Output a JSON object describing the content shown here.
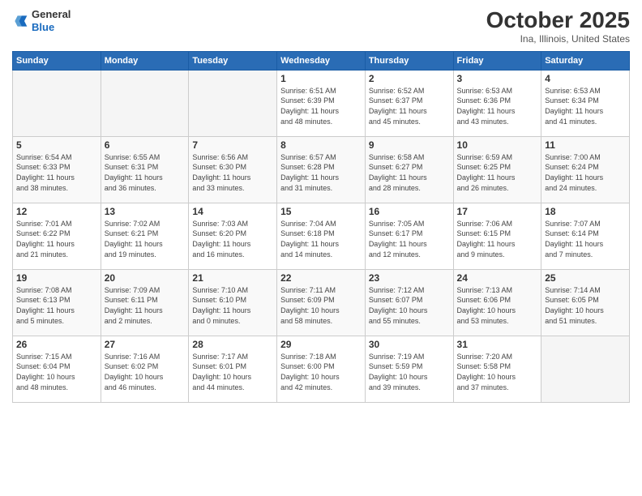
{
  "header": {
    "logo_general": "General",
    "logo_blue": "Blue",
    "month_title": "October 2025",
    "subtitle": "Ina, Illinois, United States"
  },
  "weekdays": [
    "Sunday",
    "Monday",
    "Tuesday",
    "Wednesday",
    "Thursday",
    "Friday",
    "Saturday"
  ],
  "weeks": [
    [
      {
        "day": "",
        "info": ""
      },
      {
        "day": "",
        "info": ""
      },
      {
        "day": "",
        "info": ""
      },
      {
        "day": "1",
        "info": "Sunrise: 6:51 AM\nSunset: 6:39 PM\nDaylight: 11 hours\nand 48 minutes."
      },
      {
        "day": "2",
        "info": "Sunrise: 6:52 AM\nSunset: 6:37 PM\nDaylight: 11 hours\nand 45 minutes."
      },
      {
        "day": "3",
        "info": "Sunrise: 6:53 AM\nSunset: 6:36 PM\nDaylight: 11 hours\nand 43 minutes."
      },
      {
        "day": "4",
        "info": "Sunrise: 6:53 AM\nSunset: 6:34 PM\nDaylight: 11 hours\nand 41 minutes."
      }
    ],
    [
      {
        "day": "5",
        "info": "Sunrise: 6:54 AM\nSunset: 6:33 PM\nDaylight: 11 hours\nand 38 minutes."
      },
      {
        "day": "6",
        "info": "Sunrise: 6:55 AM\nSunset: 6:31 PM\nDaylight: 11 hours\nand 36 minutes."
      },
      {
        "day": "7",
        "info": "Sunrise: 6:56 AM\nSunset: 6:30 PM\nDaylight: 11 hours\nand 33 minutes."
      },
      {
        "day": "8",
        "info": "Sunrise: 6:57 AM\nSunset: 6:28 PM\nDaylight: 11 hours\nand 31 minutes."
      },
      {
        "day": "9",
        "info": "Sunrise: 6:58 AM\nSunset: 6:27 PM\nDaylight: 11 hours\nand 28 minutes."
      },
      {
        "day": "10",
        "info": "Sunrise: 6:59 AM\nSunset: 6:25 PM\nDaylight: 11 hours\nand 26 minutes."
      },
      {
        "day": "11",
        "info": "Sunrise: 7:00 AM\nSunset: 6:24 PM\nDaylight: 11 hours\nand 24 minutes."
      }
    ],
    [
      {
        "day": "12",
        "info": "Sunrise: 7:01 AM\nSunset: 6:22 PM\nDaylight: 11 hours\nand 21 minutes."
      },
      {
        "day": "13",
        "info": "Sunrise: 7:02 AM\nSunset: 6:21 PM\nDaylight: 11 hours\nand 19 minutes."
      },
      {
        "day": "14",
        "info": "Sunrise: 7:03 AM\nSunset: 6:20 PM\nDaylight: 11 hours\nand 16 minutes."
      },
      {
        "day": "15",
        "info": "Sunrise: 7:04 AM\nSunset: 6:18 PM\nDaylight: 11 hours\nand 14 minutes."
      },
      {
        "day": "16",
        "info": "Sunrise: 7:05 AM\nSunset: 6:17 PM\nDaylight: 11 hours\nand 12 minutes."
      },
      {
        "day": "17",
        "info": "Sunrise: 7:06 AM\nSunset: 6:15 PM\nDaylight: 11 hours\nand 9 minutes."
      },
      {
        "day": "18",
        "info": "Sunrise: 7:07 AM\nSunset: 6:14 PM\nDaylight: 11 hours\nand 7 minutes."
      }
    ],
    [
      {
        "day": "19",
        "info": "Sunrise: 7:08 AM\nSunset: 6:13 PM\nDaylight: 11 hours\nand 5 minutes."
      },
      {
        "day": "20",
        "info": "Sunrise: 7:09 AM\nSunset: 6:11 PM\nDaylight: 11 hours\nand 2 minutes."
      },
      {
        "day": "21",
        "info": "Sunrise: 7:10 AM\nSunset: 6:10 PM\nDaylight: 11 hours\nand 0 minutes."
      },
      {
        "day": "22",
        "info": "Sunrise: 7:11 AM\nSunset: 6:09 PM\nDaylight: 10 hours\nand 58 minutes."
      },
      {
        "day": "23",
        "info": "Sunrise: 7:12 AM\nSunset: 6:07 PM\nDaylight: 10 hours\nand 55 minutes."
      },
      {
        "day": "24",
        "info": "Sunrise: 7:13 AM\nSunset: 6:06 PM\nDaylight: 10 hours\nand 53 minutes."
      },
      {
        "day": "25",
        "info": "Sunrise: 7:14 AM\nSunset: 6:05 PM\nDaylight: 10 hours\nand 51 minutes."
      }
    ],
    [
      {
        "day": "26",
        "info": "Sunrise: 7:15 AM\nSunset: 6:04 PM\nDaylight: 10 hours\nand 48 minutes."
      },
      {
        "day": "27",
        "info": "Sunrise: 7:16 AM\nSunset: 6:02 PM\nDaylight: 10 hours\nand 46 minutes."
      },
      {
        "day": "28",
        "info": "Sunrise: 7:17 AM\nSunset: 6:01 PM\nDaylight: 10 hours\nand 44 minutes."
      },
      {
        "day": "29",
        "info": "Sunrise: 7:18 AM\nSunset: 6:00 PM\nDaylight: 10 hours\nand 42 minutes."
      },
      {
        "day": "30",
        "info": "Sunrise: 7:19 AM\nSunset: 5:59 PM\nDaylight: 10 hours\nand 39 minutes."
      },
      {
        "day": "31",
        "info": "Sunrise: 7:20 AM\nSunset: 5:58 PM\nDaylight: 10 hours\nand 37 minutes."
      },
      {
        "day": "",
        "info": ""
      }
    ]
  ]
}
